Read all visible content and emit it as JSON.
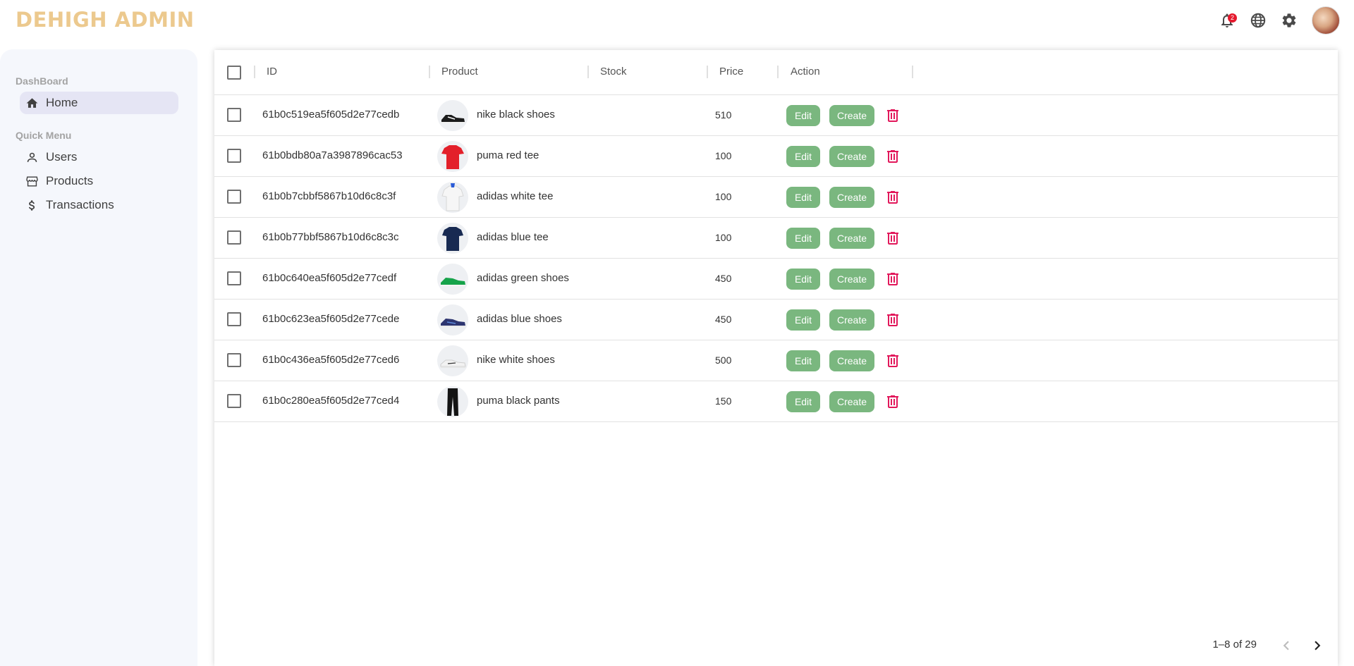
{
  "app": {
    "title": "DEHIGH ADMIN"
  },
  "topbar": {
    "icons": [
      "bell-icon",
      "globe-icon",
      "gear-icon",
      "avatar"
    ],
    "notification_count": "2"
  },
  "sidebar": {
    "sections": [
      {
        "title": "DashBoard",
        "items": [
          {
            "label": "Home",
            "icon": "home-icon",
            "active": true
          }
        ]
      },
      {
        "title": "Quick Menu",
        "items": [
          {
            "label": "Users",
            "icon": "user-icon"
          },
          {
            "label": "Products",
            "icon": "store-icon"
          },
          {
            "label": "Transactions",
            "icon": "dollar-icon"
          }
        ]
      }
    ]
  },
  "table": {
    "columns": [
      "ID",
      "Product",
      "Stock",
      "Price",
      "Action"
    ],
    "edit_label": "Edit",
    "create_label": "Create",
    "rows": [
      {
        "id": "61b0c519ea5f605d2e77cedb",
        "product": "nike black shoes",
        "stock": "",
        "price": "510",
        "thumb": "black-shoe"
      },
      {
        "id": "61b0bdb80a7a3987896cac53",
        "product": "puma red tee",
        "stock": "",
        "price": "100",
        "thumb": "red-tee"
      },
      {
        "id": "61b0b7cbbf5867b10d6c8c3f",
        "product": "adidas white tee",
        "stock": "",
        "price": "100",
        "thumb": "white-tee"
      },
      {
        "id": "61b0b77bbf5867b10d6c8c3c",
        "product": "adidas blue tee",
        "stock": "",
        "price": "100",
        "thumb": "blue-tee"
      },
      {
        "id": "61b0c640ea5f605d2e77cedf",
        "product": "adidas green shoes",
        "stock": "",
        "price": "450",
        "thumb": "green-shoe"
      },
      {
        "id": "61b0c623ea5f605d2e77cede",
        "product": "adidas blue shoes",
        "stock": "",
        "price": "450",
        "thumb": "blue-shoe"
      },
      {
        "id": "61b0c436ea5f605d2e77ced6",
        "product": "nike white shoes",
        "stock": "",
        "price": "500",
        "thumb": "white-shoe"
      },
      {
        "id": "61b0c280ea5f605d2e77ced4",
        "product": "puma black pants",
        "stock": "",
        "price": "150",
        "thumb": "black-pants"
      }
    ]
  },
  "pagination": {
    "text": "1–8 of 29"
  },
  "colors": {
    "brand": "#ecc98e",
    "button": "#7ab77f",
    "delete": "#e2185b",
    "sidebar_bg": "#f5f7fc",
    "active_item_bg": "#e5e5f4",
    "badge": "#e5192d"
  }
}
